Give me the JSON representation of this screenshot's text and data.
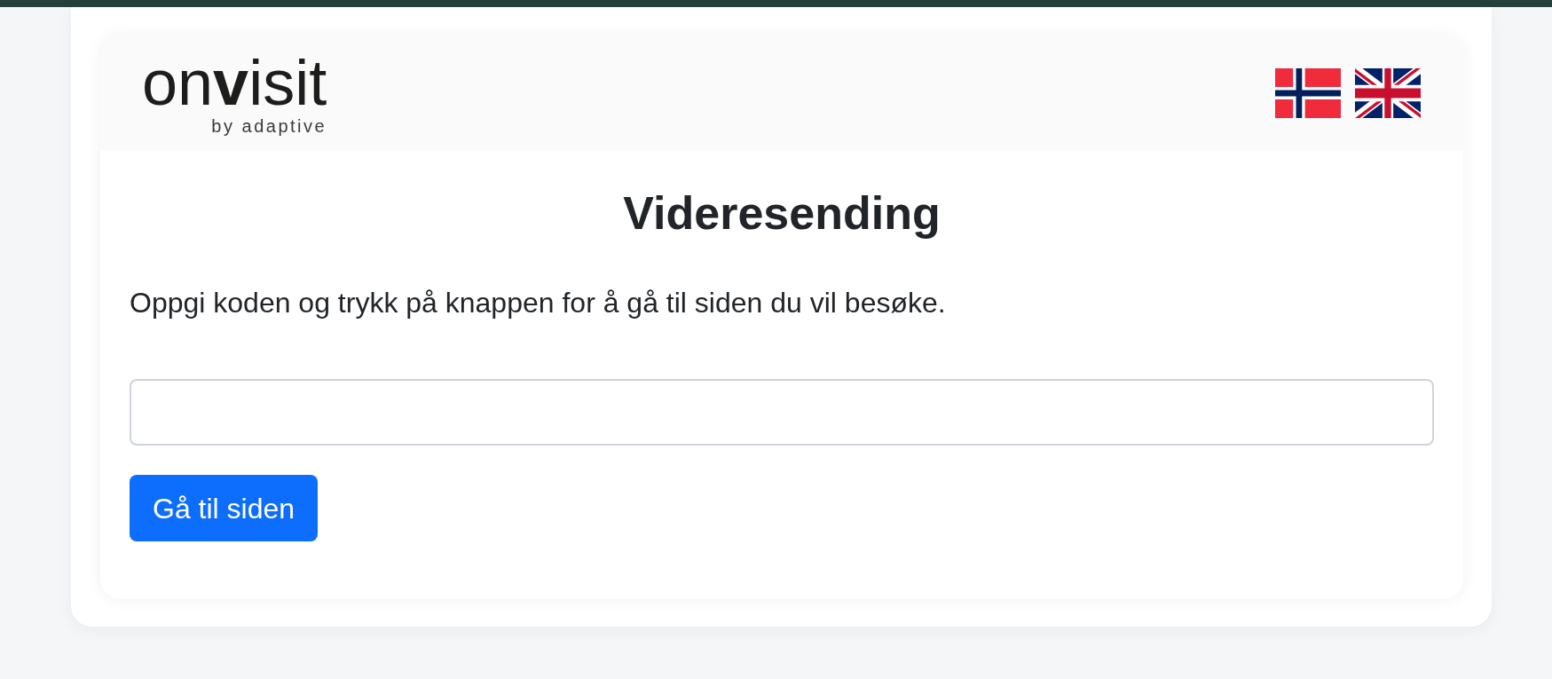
{
  "header": {
    "logo": {
      "wordmark": "on**v**isit",
      "tagline": "by adaptive"
    }
  },
  "main": {
    "title": "Videresending",
    "instruction": "Oppgi koden og trykk på knappen for å gå til siden du vil besøke.",
    "submit_button": {
      "label": "Gå til siden"
    }
  }
}
